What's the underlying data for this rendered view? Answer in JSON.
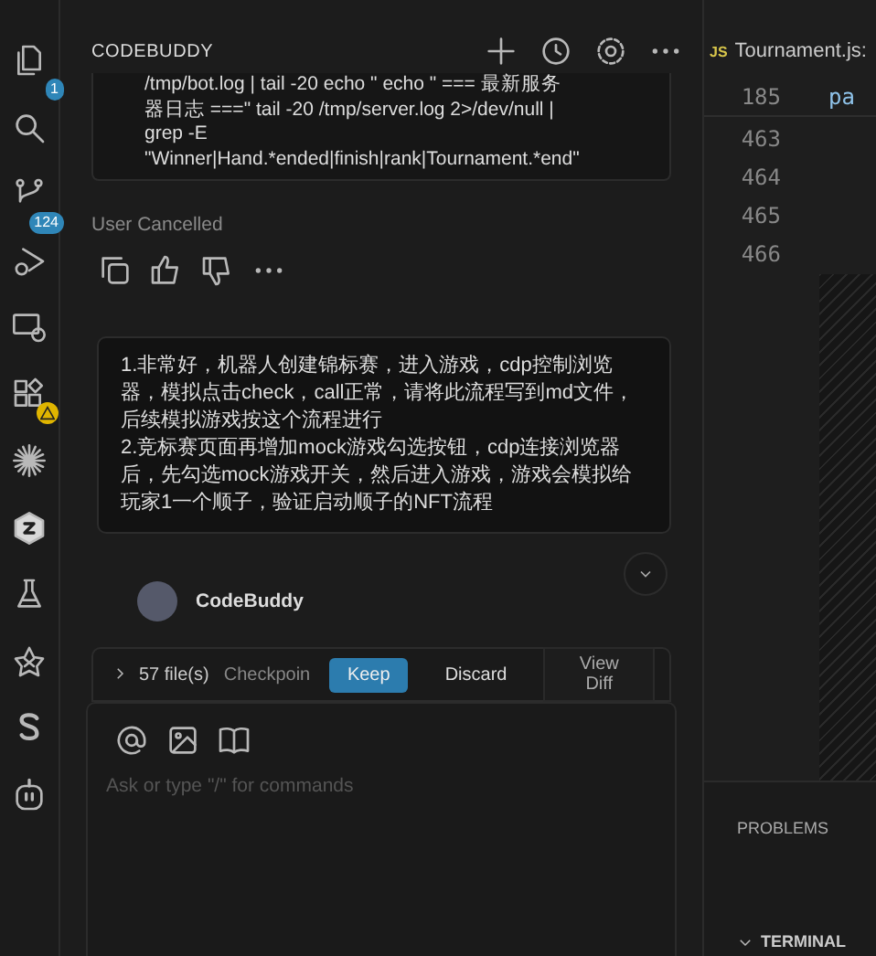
{
  "activity_bar": {
    "items": [
      {
        "kind": "files",
        "badge": "1",
        "warning": false
      },
      {
        "kind": "search",
        "warning": false
      },
      {
        "kind": "branch",
        "badge": "124",
        "warning": false
      },
      {
        "kind": "debug",
        "warning": false
      },
      {
        "kind": "remote",
        "warning": false
      },
      {
        "kind": "extensions",
        "warning": true
      },
      {
        "kind": "spark",
        "warning": false
      },
      {
        "kind": "cube",
        "warning": false
      },
      {
        "kind": "flask",
        "warning": false
      },
      {
        "kind": "star",
        "warning": false
      },
      {
        "kind": "s",
        "warning": false
      },
      {
        "kind": "robot",
        "warning": false
      }
    ]
  },
  "chat": {
    "title": "CODEBUDDY",
    "code_lines": [
      "/tmp/bot.log | tail -20 echo \"   echo \" === 最新服务",
      "器日志 ===\" tail -20 /tmp/server.log 2>/dev/null |",
      "grep -E",
      "\"Winner|Hand.*ended|finish|rank|Tournament.*end\""
    ],
    "status": "User Cancelled",
    "user_message": [
      "1.非常好，机器人创建锦标赛，进入游戏，cdp控制浏览器，模拟点击check，call正常，请将此流程写到md文件，后续模拟游戏按这个流程进行",
      "2.竞标赛页面再增加mock游戏勾选按钮，cdp连接浏览器后，先勾选mock游戏开关，然后进入游戏，游戏会模拟给玩家1一个顺子，验证启动顺子的NFT流程"
    ],
    "assistant_name": "CodeBuddy",
    "changes": {
      "files": "57 file(s)",
      "checkpoint": "Checkpoin",
      "keep": "Keep",
      "discard": "Discard",
      "view_diff": "View Diff"
    },
    "input": {
      "placeholder": "Ask or type \"/\" for commands"
    }
  },
  "editor": {
    "tab": {
      "icon": "JS",
      "label": "Tournament.js:"
    },
    "sticky_line": {
      "number": "185",
      "code": "pa"
    },
    "line_numbers": [
      "463",
      "464",
      "465",
      "466"
    ]
  },
  "panel": {
    "tabs": [
      "PROBLEMS"
    ],
    "section": "TERMINAL"
  }
}
